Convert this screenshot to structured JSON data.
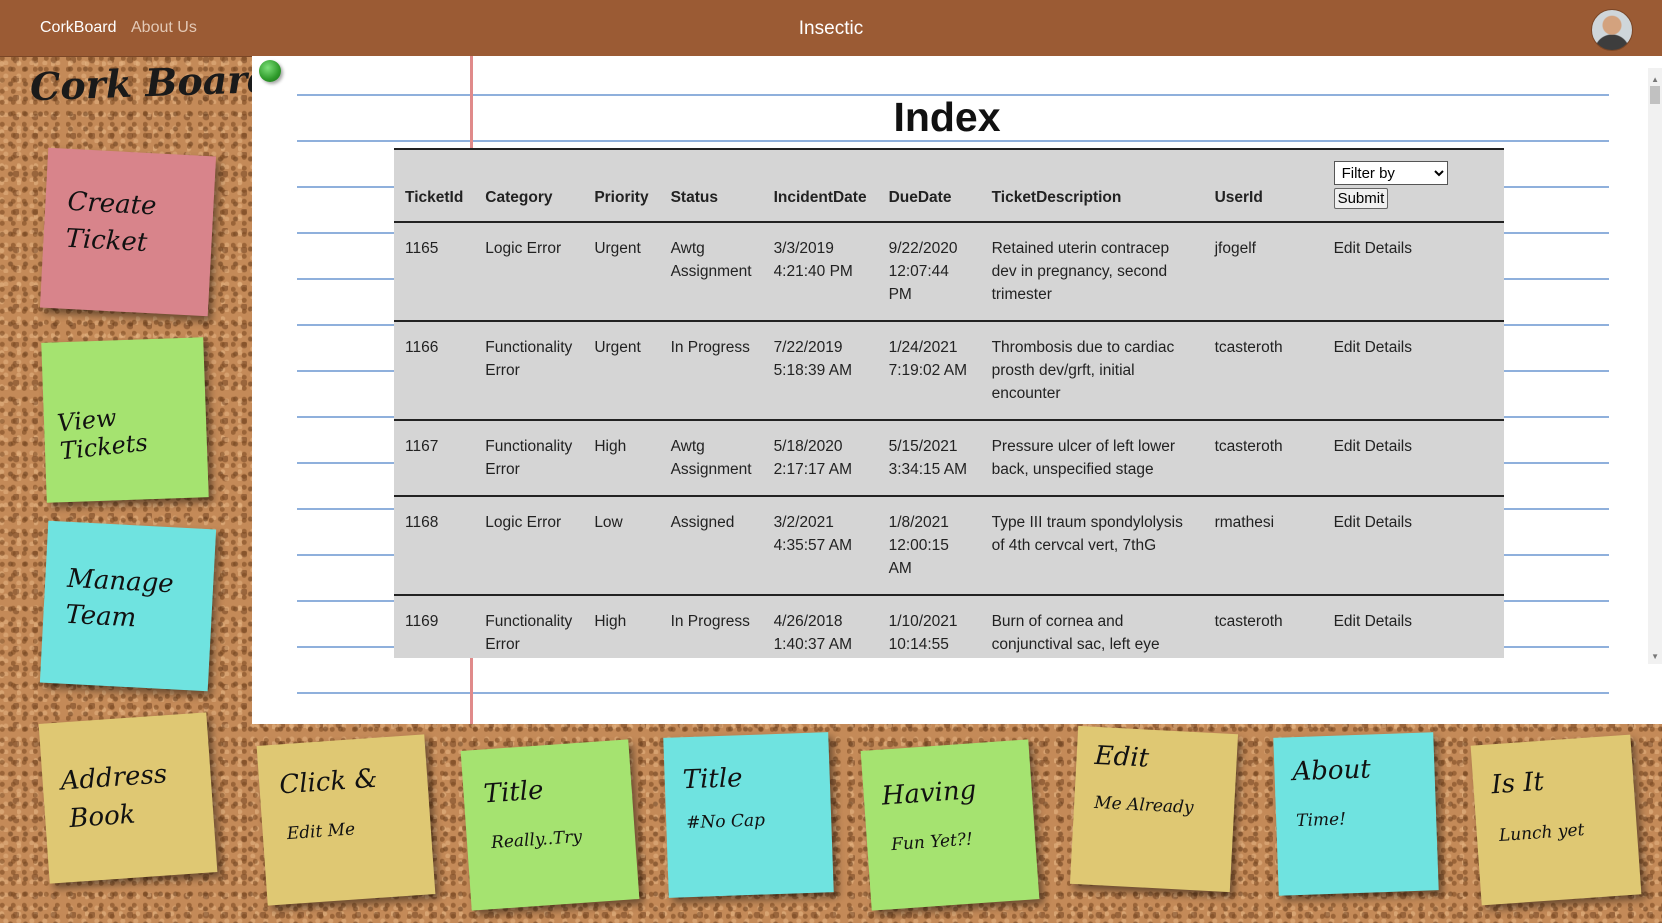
{
  "navbar": {
    "brand": "CorkBoard",
    "about": "About Us",
    "title": "Insectic"
  },
  "sidebar": {
    "title": "Cork Board",
    "notes": [
      {
        "line1": "Create",
        "line2": "Ticket"
      },
      {
        "line1": "View Tickets"
      },
      {
        "line1": "Manage",
        "line2": "Team"
      },
      {
        "line1": "Address",
        "line2": "Book"
      }
    ]
  },
  "main": {
    "title": "Index",
    "table": {
      "headers": [
        "TicketId",
        "Category",
        "Priority",
        "Status",
        "IncidentDate",
        "DueDate",
        "TicketDescription",
        "UserId"
      ],
      "filter": {
        "selected": "Filter by",
        "submit_label": "Submit"
      },
      "rows": [
        {
          "ticket_id": "1165",
          "category": "Logic Error",
          "priority": "Urgent",
          "status": "Awtg Assignment",
          "incident_date": "3/3/2019 4:21:40 PM",
          "due_date": "9/22/2020 12:07:44 PM",
          "description": "Retained uterin contracep dev in pregnancy, second trimester",
          "user_id": "jfogelf",
          "edit": "Edit",
          "details": "Details"
        },
        {
          "ticket_id": "1166",
          "category": "Functionality Error",
          "priority": "Urgent",
          "status": "In Progress",
          "incident_date": "7/22/2019 5:18:39 AM",
          "due_date": "1/24/2021 7:19:02 AM",
          "description": "Thrombosis due to cardiac prosth dev/grft, initial encounter",
          "user_id": "tcasteroth",
          "edit": "Edit",
          "details": "Details"
        },
        {
          "ticket_id": "1167",
          "category": "Functionality Error",
          "priority": "High",
          "status": "Awtg Assignment",
          "incident_date": "5/18/2020 2:17:17 AM",
          "due_date": "5/15/2021 3:34:15 AM",
          "description": "Pressure ulcer of left lower back, unspecified stage",
          "user_id": "tcasteroth",
          "edit": "Edit",
          "details": "Details"
        },
        {
          "ticket_id": "1168",
          "category": "Logic Error",
          "priority": "Low",
          "status": "Assigned",
          "incident_date": "3/2/2021 4:35:57 AM",
          "due_date": "1/8/2021 12:00:15 AM",
          "description": "Type III traum spondylolysis of 4th cervcal vert, 7thG",
          "user_id": "rmathesi",
          "edit": "Edit",
          "details": "Details"
        },
        {
          "ticket_id": "1169",
          "category": "Functionality Error",
          "priority": "High",
          "status": "In Progress",
          "incident_date": "4/26/2018 1:40:37 AM",
          "due_date": "1/10/2021 10:14:55",
          "description": "Burn of cornea and conjunctival sac, left eye",
          "user_id": "tcasteroth",
          "edit": "Edit",
          "details": "Details"
        }
      ]
    }
  },
  "bottom_notes": [
    {
      "line1": "Click &",
      "line2": "Edit Me",
      "color": "#dfc873"
    },
    {
      "line1": "Title",
      "line2": "Really..Try",
      "color": "#a5e370"
    },
    {
      "line1": "Title",
      "line2": "#No Cap",
      "color": "#6fe3e0"
    },
    {
      "line1": "Having",
      "line2": "Fun Yet?!",
      "color": "#a5e370"
    },
    {
      "line1": "Edit",
      "line2": "Me Already",
      "color": "#dfc873"
    },
    {
      "line1": "About",
      "line2": "Time!",
      "color": "#6fe3e0"
    },
    {
      "line1": "Is It",
      "line2": "Lunch yet",
      "color": "#dfc873"
    }
  ]
}
